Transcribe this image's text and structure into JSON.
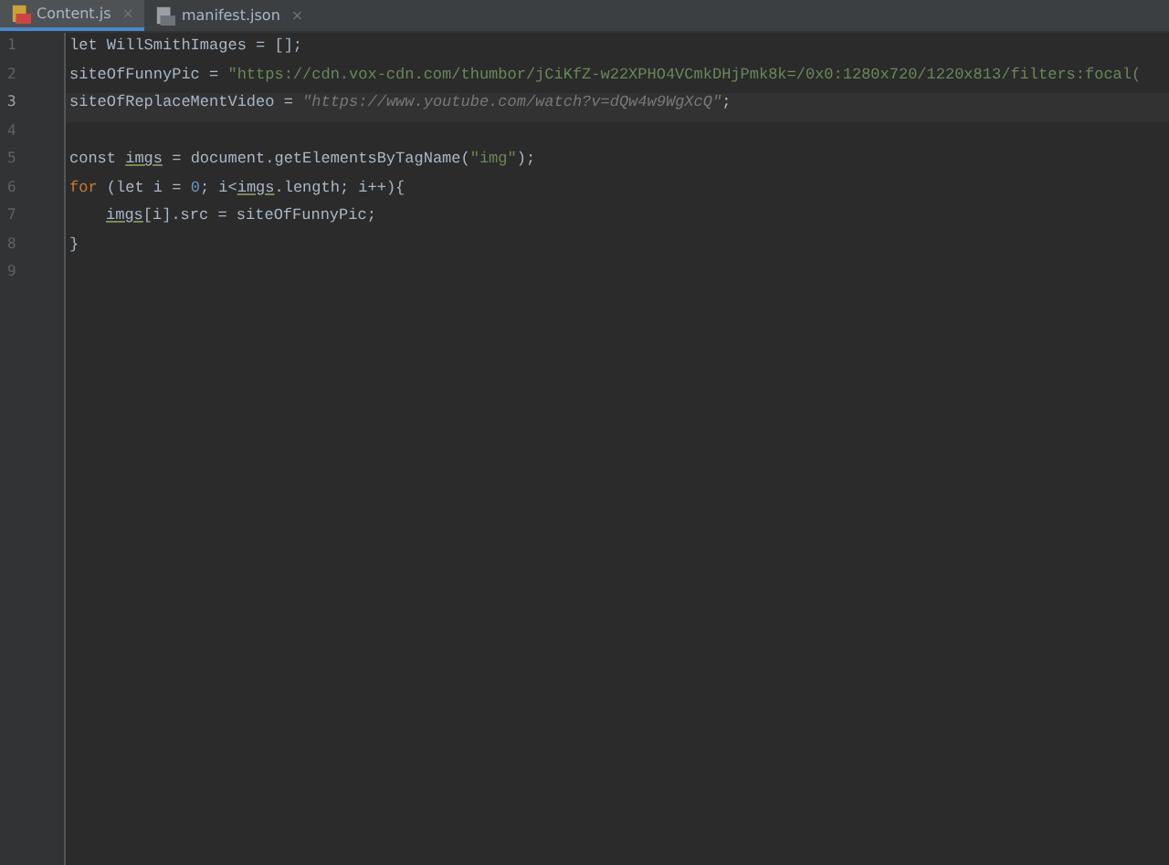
{
  "tabs": [
    {
      "label": "Content.js",
      "kind": "js",
      "selected": true,
      "close": "×"
    },
    {
      "label": "manifest.json",
      "kind": "json",
      "selected": false,
      "close": "×"
    }
  ],
  "lines": [
    {
      "number": "1",
      "selected": false,
      "tokens": [
        {
          "text": "let WillSmithImages = [];",
          "kind": "plain"
        }
      ]
    },
    {
      "number": "2",
      "selected": false,
      "tokens": [
        {
          "text": "siteOfFunnyPic = ",
          "kind": "plain"
        },
        {
          "text": "\"https://cdn.vox-cdn.com/thumbor/jCiKfZ-w22XPHO4VCmkDHjPmk8k=/0x0:1280x720/1220x813/filters:focal(",
          "kind": "string"
        }
      ]
    },
    {
      "number": "3",
      "selected": true,
      "tokens": [
        {
          "text": "siteOfReplaceMentVideo = ",
          "kind": "plain"
        },
        {
          "text": "\"https://www.youtube.com/watch?v=dQw4w9WgXcQ\"",
          "kind": "unused"
        },
        {
          "text": ";",
          "kind": "plain"
        }
      ]
    },
    {
      "number": "4",
      "selected": false
    },
    {
      "number": "5",
      "selected": false,
      "tokens": [
        {
          "text": "const ",
          "kind": "plain"
        },
        {
          "text": "imgs",
          "kind": "underlined"
        },
        {
          "text": " = document.getElementsByTagName(",
          "kind": "plain"
        },
        {
          "text": "\"img\"",
          "kind": "string"
        },
        {
          "text": ");",
          "kind": "plain"
        }
      ]
    },
    {
      "number": "6",
      "selected": false,
      "tokens": [
        {
          "text": "for",
          "kind": "keyword"
        },
        {
          "text": " (let i = ",
          "kind": "plain"
        },
        {
          "text": "0",
          "kind": "number"
        },
        {
          "text": "; i<",
          "kind": "plain"
        },
        {
          "text": "imgs",
          "kind": "underlined"
        },
        {
          "text": ".length; i++){",
          "kind": "plain"
        }
      ]
    },
    {
      "number": "7",
      "selected": false,
      "indented": true,
      "tokens": [
        {
          "text": "imgs",
          "kind": "underlined"
        },
        {
          "text": "[i].src = siteOfFunnyPic;",
          "kind": "plain"
        }
      ]
    },
    {
      "number": "8",
      "selected": false,
      "tokens": [
        {
          "text": "}",
          "kind": "plain"
        }
      ]
    },
    {
      "number": "9",
      "selected": false
    }
  ]
}
